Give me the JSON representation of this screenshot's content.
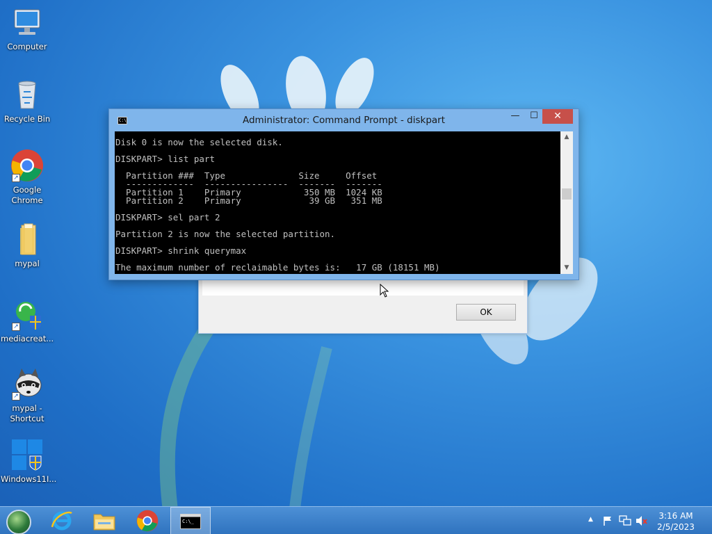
{
  "desktop": {
    "icons": [
      {
        "label_line1": "Computer",
        "label_line2": ""
      },
      {
        "label_line1": "Recycle Bin",
        "label_line2": ""
      },
      {
        "label_line1": "Google",
        "label_line2": "Chrome"
      },
      {
        "label_line1": "mypal",
        "label_line2": ""
      },
      {
        "label_line1": "mediacreat...",
        "label_line2": ""
      },
      {
        "label_line1": "mypal -",
        "label_line2": "Shortcut"
      },
      {
        "label_line1": "Windows11I...",
        "label_line2": ""
      }
    ]
  },
  "cmd_window": {
    "title": "Administrator: Command Prompt - diskpart",
    "close_symbol": "✕",
    "minimize_symbol": "—",
    "maximize_symbol": "☐",
    "lines": [
      "Disk 0 is now the selected disk.",
      "",
      "DISKPART> list part",
      "",
      "  Partition ###  Type              Size     Offset",
      "  -------------  ----------------  -------  -------",
      "  Partition 1    Primary            350 MB  1024 KB",
      "  Partition 2    Primary             39 GB   351 MB",
      "",
      "DISKPART> sel part 2",
      "",
      "Partition 2 is now the selected partition.",
      "",
      "DISKPART> shrink querymax",
      "",
      "The maximum number of reclaimable bytes is:   17 GB (18151 MB)"
    ]
  },
  "bg_dialog": {
    "ok_label": "OK"
  },
  "taskbar": {
    "time": "3:16 AM",
    "date": "2/5/2023"
  }
}
